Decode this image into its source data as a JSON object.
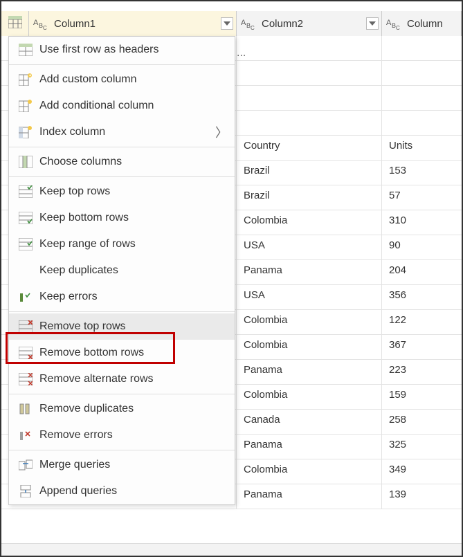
{
  "columns": {
    "col1": "Column1",
    "col2": "Column2",
    "col3": "Column"
  },
  "rows": [
    {
      "c2": "",
      "c3": ""
    },
    {
      "c2": "",
      "c3": ""
    },
    {
      "c2": "",
      "c3": ""
    },
    {
      "c2": "",
      "c3": ""
    },
    {
      "c2": "Country",
      "c3": "Units"
    },
    {
      "c2": "Brazil",
      "c3": "153"
    },
    {
      "c2": "Brazil",
      "c3": "57"
    },
    {
      "c2": "Colombia",
      "c3": "310"
    },
    {
      "c2": "USA",
      "c3": "90"
    },
    {
      "c2": "Panama",
      "c3": "204"
    },
    {
      "c2": "USA",
      "c3": "356"
    },
    {
      "c2": "Colombia",
      "c3": "122"
    },
    {
      "c2": "Colombia",
      "c3": "367"
    },
    {
      "c2": "Panama",
      "c3": "223"
    },
    {
      "c2": "Colombia",
      "c3": "159"
    },
    {
      "c2": "Canada",
      "c3": "258"
    },
    {
      "c2": "Panama",
      "c3": "325"
    },
    {
      "c2": "Colombia",
      "c3": "349"
    },
    {
      "c2": "Panama",
      "c3": "139"
    }
  ],
  "menu": {
    "first_row_headers": "Use first row as headers",
    "add_custom": "Add custom column",
    "add_conditional": "Add conditional column",
    "index": "Index column",
    "choose": "Choose columns",
    "keep_top": "Keep top rows",
    "keep_bottom": "Keep bottom rows",
    "keep_range": "Keep range of rows",
    "keep_dupes": "Keep duplicates",
    "keep_errors": "Keep errors",
    "remove_top": "Remove top rows",
    "remove_bottom": "Remove bottom rows",
    "remove_alt": "Remove alternate rows",
    "remove_dupes": "Remove duplicates",
    "remove_errors": "Remove errors",
    "merge": "Merge queries",
    "append": "Append queries"
  },
  "ellipsis": "..."
}
